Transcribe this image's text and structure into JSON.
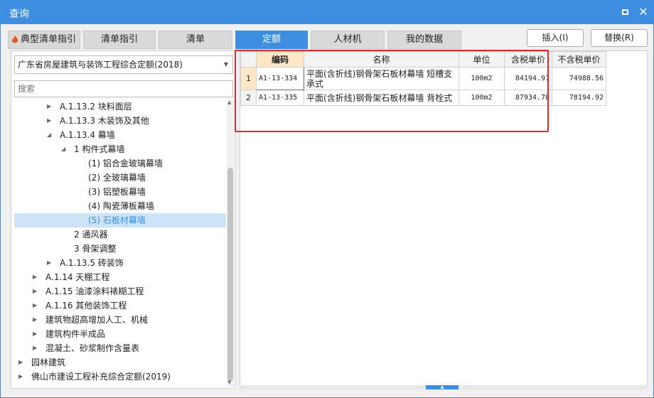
{
  "window": {
    "title": "查询"
  },
  "tabs": [
    {
      "label": "典型清单指引"
    },
    {
      "label": "清单指引"
    },
    {
      "label": "清单"
    },
    {
      "label": "定额"
    },
    {
      "label": "人材机"
    },
    {
      "label": "我的数据"
    }
  ],
  "toolbar": {
    "insert_label": "插入(I)",
    "replace_label": "替换(R)"
  },
  "left": {
    "selected_db": "广东省房屋建筑与装饰工程综合定额(2018)",
    "search_placeholder": "搜索",
    "tree": [
      {
        "label": "A.1.13.2 块料面层"
      },
      {
        "label": "A.1.13.3 木装饰及其他"
      },
      {
        "label": "A.1.13.4 幕墙"
      },
      {
        "label": "1 构件式幕墙"
      },
      {
        "label": "(1) 铝合金玻璃幕墙"
      },
      {
        "label": "(2) 全玻璃幕墙"
      },
      {
        "label": "(3) 铝塑板幕墙"
      },
      {
        "label": "(4) 陶瓷薄板幕墙"
      },
      {
        "label": "(5) 石板材幕墙"
      },
      {
        "label": "2 通风器"
      },
      {
        "label": "3 骨架调整"
      },
      {
        "label": "A.1.13.5 砖装饰"
      },
      {
        "label": "A.1.14 天棚工程"
      },
      {
        "label": "A.1.15 油漆涂料裱糊工程"
      },
      {
        "label": "A.1.16 其他装饰工程"
      },
      {
        "label": "建筑物超高增加人工、机械"
      },
      {
        "label": "建筑构件半成品"
      },
      {
        "label": "混凝土、砂浆制作含量表"
      },
      {
        "label": "园林建筑"
      },
      {
        "label": "佛山市建设工程补充综合定额(2019)"
      }
    ]
  },
  "grid": {
    "headers": {
      "code": "编码",
      "name": "名称",
      "unit": "单位",
      "price_tax": "含税单价",
      "price_notax": "不含税单价"
    },
    "rows": [
      {
        "idx": "1",
        "code": "A1-13-334",
        "name": "平面(含折线)钢骨架石板材幕墙 短槽支承式",
        "unit": "100m2",
        "price_tax": "84194.91",
        "price_notax": "74988.56"
      },
      {
        "idx": "2",
        "code": "A1-13-335",
        "name": "平面(含折线)钢骨架石板材幕墙 背栓式",
        "unit": "100m2",
        "price_tax": "87934.78",
        "price_notax": "78194.92"
      }
    ]
  }
}
